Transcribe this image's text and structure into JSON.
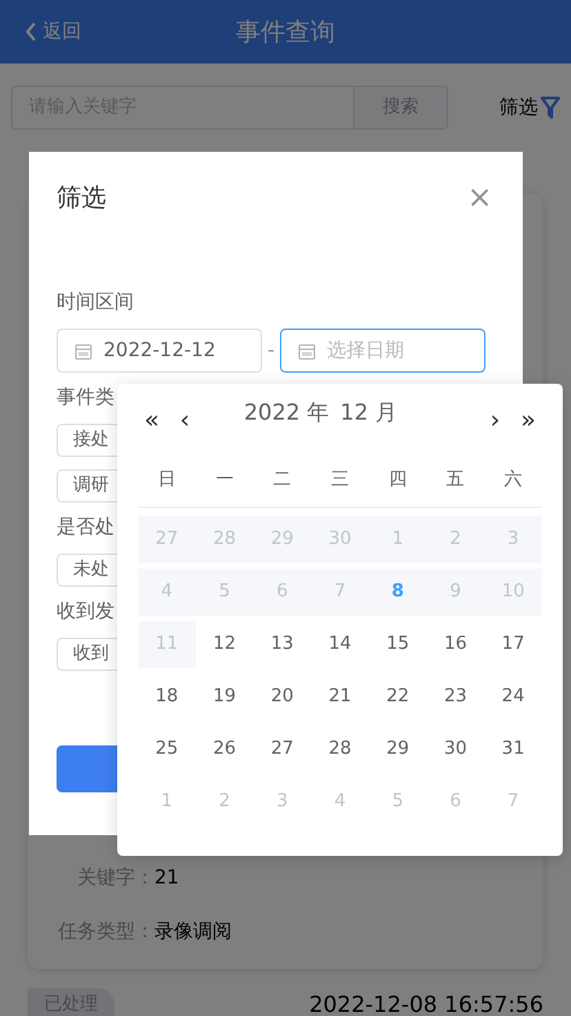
{
  "header": {
    "back": "返回",
    "title": "事件查询"
  },
  "search": {
    "placeholder": "请输入关键字",
    "button": "搜索",
    "filter": "筛选"
  },
  "card": {
    "fields": [
      {
        "label": "关键字：",
        "value": "21"
      },
      {
        "label": "任务类型：",
        "value": "录像调阅"
      }
    ]
  },
  "next_card": {
    "badge": "已处理",
    "time": "2022-12-08 16:57:56"
  },
  "modal": {
    "title": "筛选",
    "close": "×",
    "sections": [
      {
        "label": "时间区间",
        "kind": "range",
        "start": "2022-12-12",
        "separator": "-",
        "end_placeholder": "选择日期",
        "end_focused": true
      },
      {
        "label": "事件类",
        "kind": "chips",
        "chips": [
          "接处",
          "调研"
        ]
      },
      {
        "label": "是否处",
        "kind": "chips",
        "chips": [
          "未处"
        ]
      },
      {
        "label": "收到发",
        "kind": "chips",
        "chips": [
          "收到"
        ]
      }
    ]
  },
  "calendar": {
    "year": "2022 年",
    "month": "12 月",
    "prev_year": "«",
    "prev_month": "‹",
    "next_month": "›",
    "next_year": "»",
    "weekdays": [
      "日",
      "一",
      "二",
      "三",
      "四",
      "五",
      "六"
    ],
    "weeks": [
      [
        {
          "day": "27",
          "kind": "disabled"
        },
        {
          "day": "28",
          "kind": "disabled"
        },
        {
          "day": "29",
          "kind": "disabled"
        },
        {
          "day": "30",
          "kind": "disabled"
        },
        {
          "day": "1",
          "kind": "disabled"
        },
        {
          "day": "2",
          "kind": "disabled"
        },
        {
          "day": "3",
          "kind": "disabled"
        }
      ],
      [
        {
          "day": "4",
          "kind": "disabled"
        },
        {
          "day": "5",
          "kind": "disabled"
        },
        {
          "day": "6",
          "kind": "disabled"
        },
        {
          "day": "7",
          "kind": "disabled"
        },
        {
          "day": "8",
          "kind": "today"
        },
        {
          "day": "9",
          "kind": "disabled"
        },
        {
          "day": "10",
          "kind": "disabled"
        }
      ],
      [
        {
          "day": "11",
          "kind": "disabled"
        },
        {
          "day": "12",
          "kind": "day"
        },
        {
          "day": "13",
          "kind": "day"
        },
        {
          "day": "14",
          "kind": "day"
        },
        {
          "day": "15",
          "kind": "day"
        },
        {
          "day": "16",
          "kind": "day"
        },
        {
          "day": "17",
          "kind": "day"
        }
      ],
      [
        {
          "day": "18",
          "kind": "day"
        },
        {
          "day": "19",
          "kind": "day"
        },
        {
          "day": "20",
          "kind": "day"
        },
        {
          "day": "21",
          "kind": "day"
        },
        {
          "day": "22",
          "kind": "day"
        },
        {
          "day": "23",
          "kind": "day"
        },
        {
          "day": "24",
          "kind": "day"
        }
      ],
      [
        {
          "day": "25",
          "kind": "day"
        },
        {
          "day": "26",
          "kind": "day"
        },
        {
          "day": "27",
          "kind": "day"
        },
        {
          "day": "28",
          "kind": "day"
        },
        {
          "day": "29",
          "kind": "day"
        },
        {
          "day": "30",
          "kind": "day"
        },
        {
          "day": "31",
          "kind": "day"
        }
      ],
      [
        {
          "day": "1",
          "kind": "next"
        },
        {
          "day": "2",
          "kind": "next"
        },
        {
          "day": "3",
          "kind": "next"
        },
        {
          "day": "4",
          "kind": "next"
        },
        {
          "day": "5",
          "kind": "next"
        },
        {
          "day": "6",
          "kind": "next"
        },
        {
          "day": "7",
          "kind": "next"
        }
      ]
    ]
  }
}
